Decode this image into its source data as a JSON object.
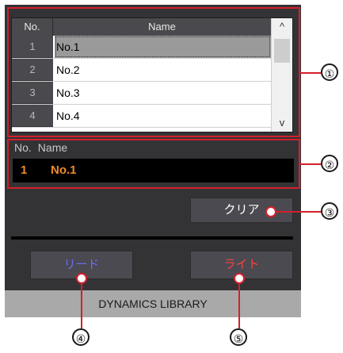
{
  "list": {
    "header_no": "No.",
    "header_name": "Name",
    "rows": [
      {
        "no": "1",
        "name": "No.1"
      },
      {
        "no": "2",
        "name": "No.2"
      },
      {
        "no": "3",
        "name": "No.3"
      },
      {
        "no": "4",
        "name": "No.4"
      }
    ],
    "scroll_up": "^",
    "scroll_down": "v"
  },
  "current": {
    "header_no": "No.",
    "header_name": "Name",
    "no": "1",
    "name": "No.1"
  },
  "buttons": {
    "clear": "クリア",
    "read": "リード",
    "write": "ライト"
  },
  "footer_title": "DYNAMICS LIBRARY",
  "callouts": [
    "①",
    "②",
    "③",
    "④",
    "⑤"
  ],
  "colors": {
    "callout": "#d4202a",
    "current_text": "#f08c28",
    "read": "#6b6bff",
    "write": "#ff4040"
  }
}
